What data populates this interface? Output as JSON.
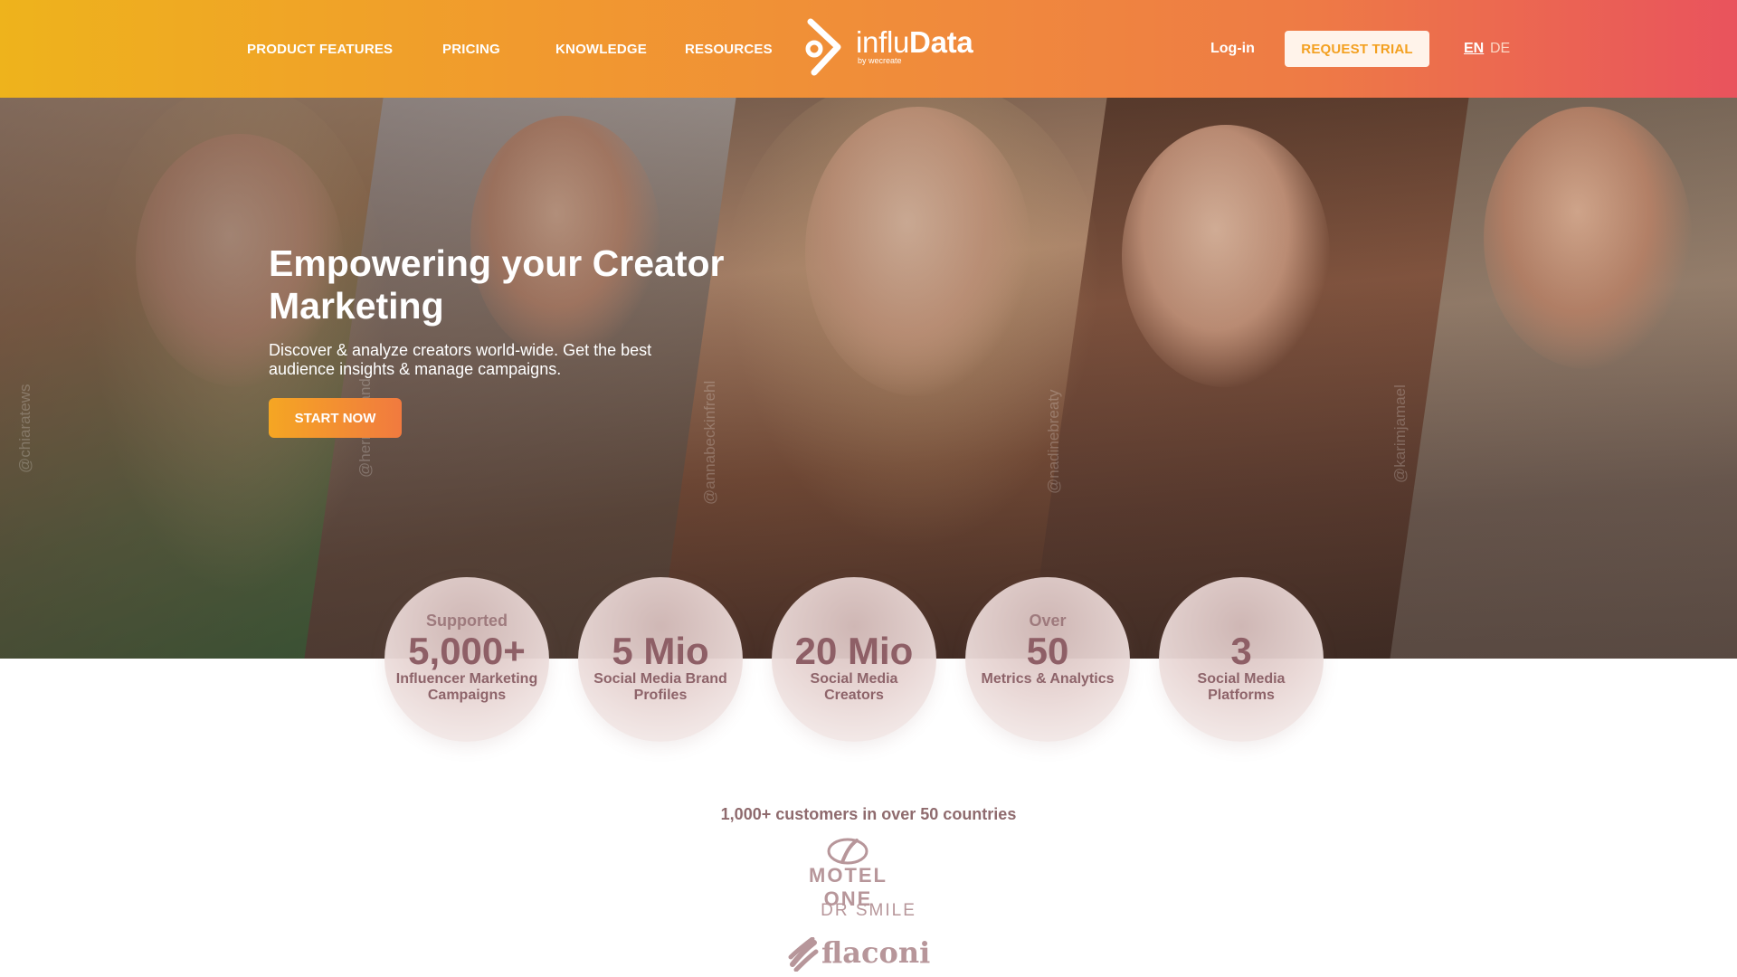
{
  "nav": {
    "items": [
      {
        "label": "PRODUCT FEATURES"
      },
      {
        "label": "PRICING"
      },
      {
        "label": "KNOWLEDGE"
      },
      {
        "label": "RESOURCES"
      }
    ],
    "logo": {
      "name_light": "influ",
      "name_bold": "Data",
      "tagline": "by wecreate"
    },
    "login_label": "Log-in",
    "trial_label": "REQUEST TRIAL",
    "lang_active": "EN",
    "lang_other": "DE"
  },
  "hero": {
    "title": "Empowering your Creator Marketing",
    "subtitle": "Discover & analyze creators world-wide. Get the best audience insights & manage campaigns.",
    "cta_label": "START NOW",
    "handles": [
      "@chiaratews",
      "@herrenbrand",
      "@annabeckinfrehl",
      "@nadinebreaty",
      "@karimjamael"
    ]
  },
  "stats": [
    {
      "pre": "Supported",
      "value": "5,000+",
      "label": "Influencer Marketing Campaigns"
    },
    {
      "pre": "",
      "value": "5 Mio",
      "label": "Social Media Brand Profiles"
    },
    {
      "pre": "",
      "value": "20 Mio",
      "label": "Social Media Creators"
    },
    {
      "pre": "Over",
      "value": "50",
      "label": "Metrics & Analytics"
    },
    {
      "pre": "",
      "value": "3",
      "label": "Social Media Platforms"
    }
  ],
  "customers": {
    "headline": "1,000+ customers in over 50 countries",
    "brands": [
      "MOTEL ONE",
      "DR SMILE",
      "flaconi"
    ]
  }
}
